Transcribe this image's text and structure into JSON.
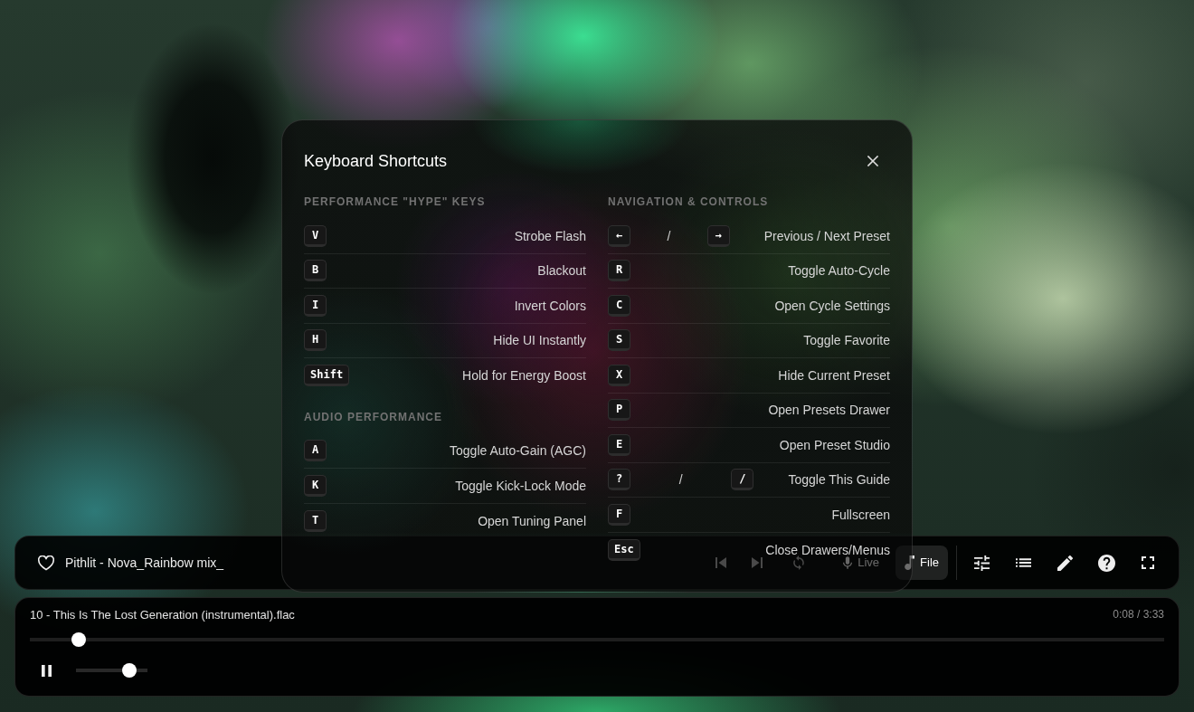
{
  "toolbar": {
    "favorite": false,
    "preset_name": "Pithlit - Nova_Rainbow mix_",
    "modes": [
      {
        "kind": "live",
        "label": "Live",
        "selected": false
      },
      {
        "kind": "file",
        "label": "File",
        "selected": true
      }
    ]
  },
  "player": {
    "file_name": "10 - This Is The Lost Generation (instrumental).flac",
    "time": "0:08 / 3:33",
    "playing": true,
    "seek": {
      "level": 0.043
    },
    "volume": {
      "level": 0.75
    }
  },
  "shortcuts_dialog": {
    "title": "Keyboard Shortcuts",
    "columns": [
      {
        "sections": [
          {
            "heading": "PERFORMANCE \"HYPE\" KEYS",
            "shortcuts": [
              {
                "keys": [
                  "V"
                ],
                "action": "Strobe Flash"
              },
              {
                "keys": [
                  "B"
                ],
                "action": "Blackout"
              },
              {
                "keys": [
                  "I"
                ],
                "action": "Invert Colors"
              },
              {
                "keys": [
                  "H"
                ],
                "action": "Hide UI Instantly"
              },
              {
                "keys": [
                  "Shift"
                ],
                "action": "Hold for Energy Boost"
              }
            ]
          },
          {
            "heading": "AUDIO PERFORMANCE",
            "shortcuts": [
              {
                "keys": [
                  "A"
                ],
                "action": "Toggle Auto-Gain (AGC)"
              },
              {
                "keys": [
                  "K"
                ],
                "action": "Toggle Kick-Lock Mode"
              },
              {
                "keys": [
                  "T"
                ],
                "action": "Open Tuning Panel"
              }
            ]
          }
        ]
      },
      {
        "sections": [
          {
            "heading": "NAVIGATION & CONTROLS",
            "shortcuts": [
              {
                "keys": [
                  "←",
                  "→"
                ],
                "separator": "/",
                "action": "Previous / Next Preset"
              },
              {
                "keys": [
                  "R"
                ],
                "action": "Toggle Auto-Cycle"
              },
              {
                "keys": [
                  "C"
                ],
                "action": "Open Cycle Settings"
              },
              {
                "keys": [
                  "S"
                ],
                "action": "Toggle Favorite"
              },
              {
                "keys": [
                  "X"
                ],
                "action": "Hide Current Preset"
              },
              {
                "keys": [
                  "P"
                ],
                "action": "Open Presets Drawer"
              },
              {
                "keys": [
                  "E"
                ],
                "action": "Open Preset Studio"
              },
              {
                "keys": [
                  "?",
                  "/"
                ],
                "separator": "/",
                "action": "Toggle This Guide"
              },
              {
                "keys": [
                  "F"
                ],
                "action": "Fullscreen"
              },
              {
                "keys": [
                  "Esc"
                ],
                "action": "Close Drawers/Menus"
              }
            ]
          }
        ]
      }
    ]
  }
}
